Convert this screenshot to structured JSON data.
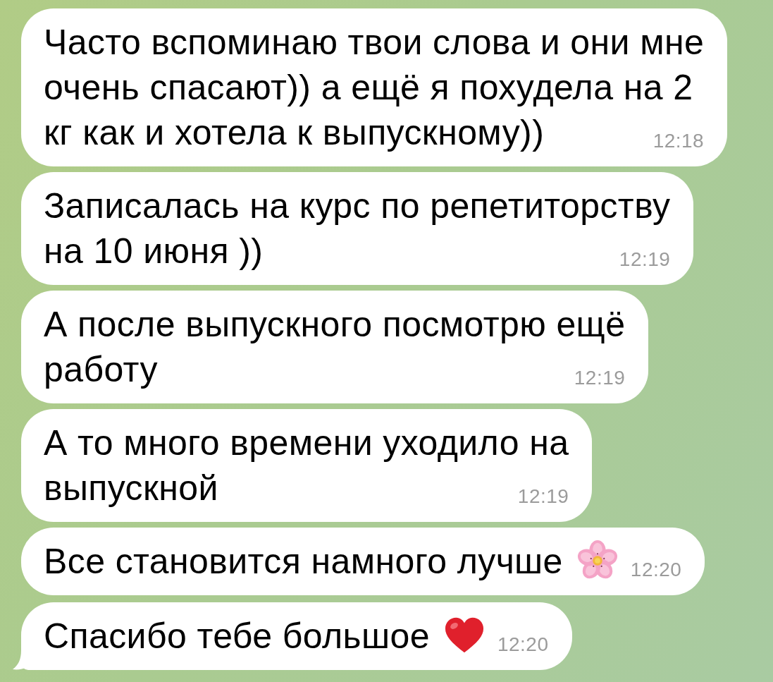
{
  "messages": [
    {
      "lines": [
        "Часто вспоминаю твои слова и они мне",
        "очень спасают)) а ещё я похудела на 2",
        "кг как и хотела к выпускному))"
      ],
      "kind": "plain",
      "time": "12:18",
      "tail": false
    },
    {
      "lines": [
        "Записалась на курс по репетиторству",
        "на 10 июня ))"
      ],
      "kind": "plain",
      "time": "12:19",
      "tail": false
    },
    {
      "lines": [
        "А после выпускного посмотрю ещё",
        "работу"
      ],
      "kind": "plain",
      "time": "12:19",
      "tail": false
    },
    {
      "lines": [
        "А то много времени уходило на",
        "выпускной"
      ],
      "kind": "plain",
      "time": "12:19",
      "tail": false
    },
    {
      "lines": [
        "Все становится намного лучше"
      ],
      "kind": "flower",
      "time": "12:20",
      "tail": false
    },
    {
      "lines": [
        "Спасибо тебе большое"
      ],
      "kind": "heart",
      "time": "12:20",
      "tail": true
    }
  ]
}
